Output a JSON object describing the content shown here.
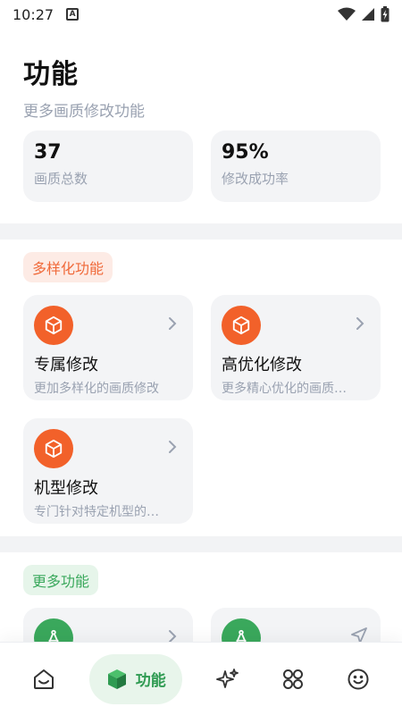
{
  "status_bar": {
    "time": "10:27",
    "notif_letter": "A"
  },
  "header": {
    "title": "功能",
    "subtitle": "更多画质修改功能"
  },
  "stats": [
    {
      "value": "37",
      "label": "画质总数"
    },
    {
      "value": "95%",
      "label": "修改成功率"
    }
  ],
  "sections": {
    "diverse": {
      "tag": "多样化功能",
      "cards": [
        {
          "title": "专属修改",
          "desc": "更加多样化的画质修改"
        },
        {
          "title": "高优化修改",
          "desc": "更多精心优化的画质…"
        },
        {
          "title": "机型修改",
          "desc": "专门针对特定机型的…"
        }
      ]
    },
    "more": {
      "tag": "更多功能"
    }
  },
  "bottom_nav": {
    "active_label": "功能"
  },
  "colors": {
    "accent_orange": "#f2612a",
    "accent_green": "#3aa85c"
  }
}
